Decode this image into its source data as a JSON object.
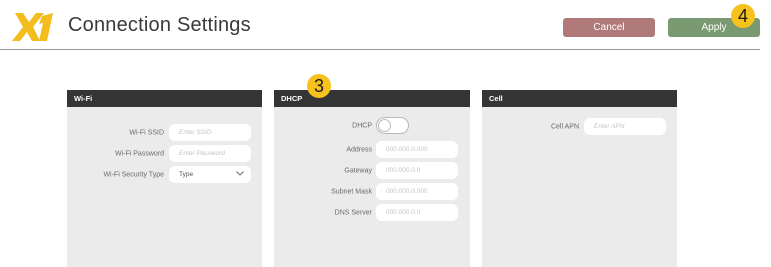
{
  "header": {
    "title": "Connection Settings",
    "logo_icon": "x1-logo-icon",
    "cancel_label": "Cancel",
    "apply_label": "Apply",
    "marker_apply": "4",
    "marker_dhcp": "3",
    "colors": {
      "logo": "#f2bd1d",
      "cancel": "#b07a7a",
      "apply": "#7a9a71",
      "panel_header": "#353535"
    }
  },
  "wifi": {
    "title": "Wi-Fi",
    "ssid_label": "Wi-Fi SSID",
    "ssid_placeholder": "Enter SSID",
    "password_label": "Wi-Fi Password",
    "password_placeholder": "Enter Password",
    "security_label": "Wi-Fi Security Type",
    "security_value": "Type"
  },
  "dhcp": {
    "title": "DHCP",
    "dhcp_label": "DHCP",
    "address_label": "Address",
    "address_placeholder": "000.000.0.000",
    "gateway_label": "Gateway",
    "gateway_placeholder": "000.000.0.0",
    "subnet_label": "Subnet Mask",
    "subnet_placeholder": "000.000.0.000",
    "dns_label": "DNS Server",
    "dns_placeholder": "000.000.0.0"
  },
  "cell": {
    "title": "Cell",
    "apn_label": "Cell APN",
    "apn_placeholder": "Enter APN"
  }
}
